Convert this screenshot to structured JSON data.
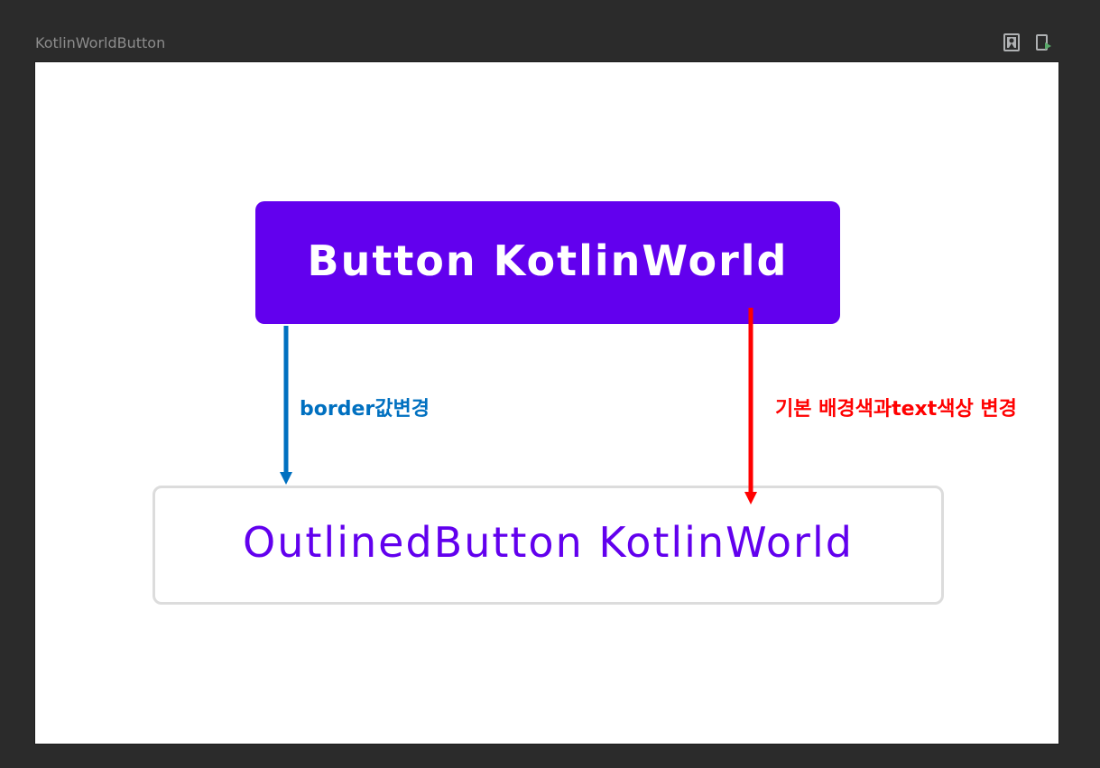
{
  "preview": {
    "title": "KotlinWorldButton",
    "icons": [
      "rerun-preview-icon",
      "deploy-preview-icon"
    ]
  },
  "buttons": {
    "primary_label": "Button KotlinWorld",
    "outlined_label": "OutlinedButton KotlinWorld"
  },
  "annotations": {
    "border_change": "border값변경",
    "color_change": "기본 배경색과text색상 변경"
  },
  "colors": {
    "primary": "#6200ee",
    "annotation_blue": "#0070c0",
    "annotation_red": "#ff0000",
    "outline_border": "#dcdcdc",
    "ide_background": "#2b2b2b"
  }
}
